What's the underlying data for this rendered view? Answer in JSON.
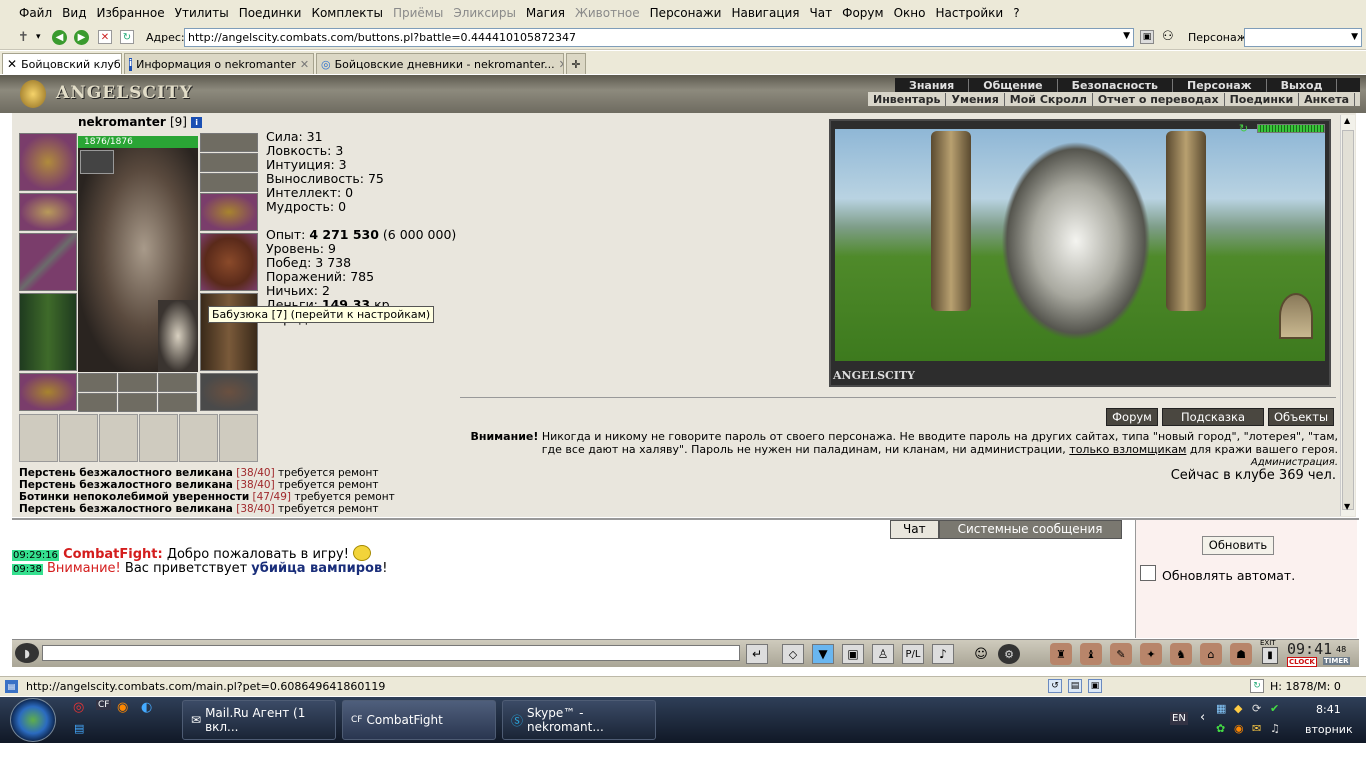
{
  "menu": [
    "Файл",
    "Вид",
    "Избранное",
    "Утилиты",
    "Поединки",
    "Комплекты",
    "Приёмы",
    "Эликсиры",
    "Магия",
    "Животное",
    "Персонажи",
    "Навигация",
    "Чат",
    "Форум",
    "Окно",
    "Настройки",
    "?"
  ],
  "menu_disabled": [
    "Приёмы",
    "Эликсиры",
    "Животное"
  ],
  "addr": {
    "label": "Адрес:",
    "url": "http://angelscity.combats.com/buttons.pl?battle=0.444410105872347",
    "char_label": "Персонаж:"
  },
  "tabs": [
    {
      "label": "Бойцовский клуб"
    },
    {
      "label": "Информация о nekromanter"
    },
    {
      "label": "Бойцовские дневники - nekromanter..."
    }
  ],
  "logo": "ANGELSCITY",
  "nav_top": [
    "Знания",
    "Общение",
    "Безопасность",
    "Персонаж",
    "Выход"
  ],
  "nav_bottom": [
    "Инвентарь",
    "Умения",
    "Мой Скролл",
    "Отчет о переводах",
    "Поединки",
    "Анкета"
  ],
  "character": {
    "name": "nekromanter",
    "level": "[9]",
    "hp": "1876/1876",
    "hp_fraction": 1.0
  },
  "stats": {
    "sila": "Сила: 31",
    "lovkost": "Ловкость: 3",
    "intuicia": "Интуиция: 3",
    "vynoslivost": "Выносливость: 75",
    "intellekt": "Интеллект: 0",
    "mudrost": "Мудрость: 0",
    "opyt_label": "Опыт: ",
    "opyt_value": "4 271 530",
    "opyt_next": " (6 000 000)",
    "uroven": "Уровень: 9",
    "pobed": "Побед: 3 738",
    "porazheniy": "Поражений: 785",
    "nichyh": "Ничьих: 2",
    "dengi_label": "Деньги: ",
    "dengi_value": "149.33",
    "dengi_unit": " кр.",
    "peredach": "Передач: 200"
  },
  "tooltip": "Бабузюка [7] (перейти к настройкам)",
  "preview_caption": "ANGELSCITY",
  "repairs": [
    {
      "name": "Перстень безжалостного великана",
      "dur": "[38/40]",
      "note": "требуется ремонт"
    },
    {
      "name": "Перстень безжалостного великана",
      "dur": "[38/40]",
      "note": "требуется ремонт"
    },
    {
      "name": "Ботинки непоколебимой уверенности",
      "dur": "[47/49]",
      "note": "требуется ремонт"
    },
    {
      "name": "Перстень безжалостного великана",
      "dur": "[38/40]",
      "note": "требуется ремонт"
    }
  ],
  "buttons": {
    "forum": "Форум",
    "hint": "Подсказка",
    "objects": "Объекты"
  },
  "warning": {
    "bold": "Внимание!",
    "text1": " Никогда и никому не говорите пароль от своего персонажа. Не вводите пароль на других сайтах, типа \"новый город\", \"лотерея\", \"там, где все дают на халяву\". Пароль не нужен ни паладинам, ни кланам, ни администрации, ",
    "link": "только взломщикам",
    "text2": " для кражи вашего героя.",
    "sign": "Администрация."
  },
  "online": "Сейчас в клубе 369 чел.",
  "chat_tabs": [
    "Чат",
    "Системные сообщения"
  ],
  "chat": [
    {
      "time": "09:29:16",
      "author": "CombatFight:",
      "text": " Добро пожаловать в игру!"
    },
    {
      "time": "09:38",
      "attn": "Внимание!",
      "text": " Вас приветствует ",
      "bold": "убийца вампиров",
      "end": "!"
    }
  ],
  "chat_panel": {
    "refresh": "Обновить",
    "auto": "Обновлять автомат."
  },
  "clock": {
    "time": "09:41",
    "sec": "48",
    "clock_label": "CLOCK",
    "timer_label": "TIMER",
    "exit": "EXIT"
  },
  "status_url": "http://angelscity.combats.com/main.pl?pet=0.608649641860119",
  "status_right": "H: 1878/M: 0",
  "taskbar": {
    "items": [
      "Mail.Ru Агент (1 вкл...",
      "CombatFight",
      "Skype™ - nekromant..."
    ],
    "lang": "EN",
    "time": "8:41",
    "day": "вторник"
  },
  "colors": {
    "accent_green": "#2aa535",
    "menu_bg": "#ece9d8",
    "chat_author": "#d41d1d",
    "chat_bold": "#1a2e7a",
    "time_bg": "#35e08f"
  }
}
